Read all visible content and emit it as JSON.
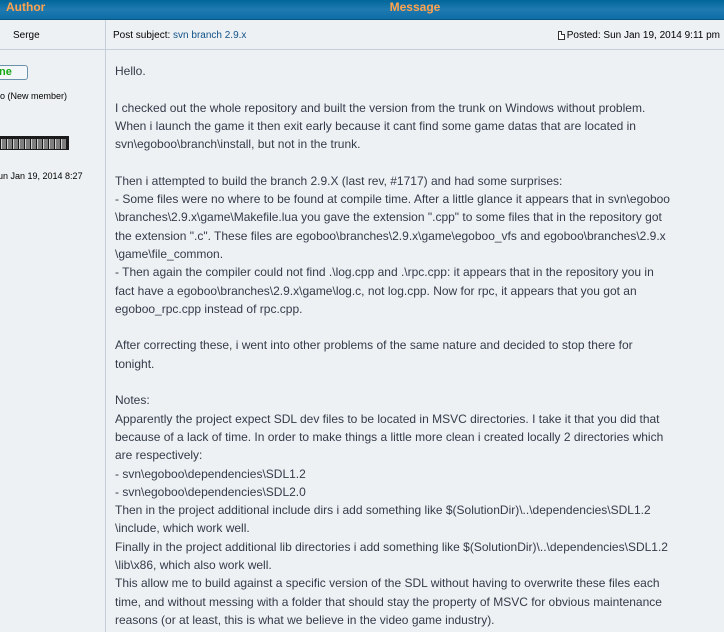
{
  "header": {
    "author": "Author",
    "message": "Message"
  },
  "post": {
    "author": "Serge",
    "subject_prefix": "Post subject:",
    "subject": "svn branch 2.9.x",
    "posted": "Posted: Sun Jan 19, 2014 9:11 pm"
  },
  "profile": {
    "online": "ne",
    "rank": "o (New member)",
    "joined": "un Jan 19, 2014 8:27"
  },
  "message": {
    "lines": [
      "Hello.",
      "",
      "I checked out the whole repository and built the version from the trunk on Windows without problem.",
      "When i launch the game it then exit early because it cant find some game datas that are located in",
      "svn\\egoboo\\branch\\install, but not in the trunk.",
      "",
      "Then i attempted to build the branch 2.9.X (last rev, #1717) and had some surprises:",
      "- Some files were no where to be found at compile time. After a little glance it appears that in svn\\egoboo",
      "\\branches\\2.9.x\\game\\Makefile.lua you gave the extension \".cpp\" to some files that in the repository got",
      "the extension \".c\". These files are egoboo\\branches\\2.9.x\\game\\egoboo_vfs and egoboo\\branches\\2.9.x",
      "\\game\\file_common.",
      "- Then again the compiler could not find .\\log.cpp and .\\rpc.cpp: it appears that in the repository you in",
      "fact have a egoboo\\branches\\2.9.x\\game\\log.c, not log.cpp. Now for rpc, it appears that you got an",
      "egoboo_rpc.cpp instead of rpc.cpp.",
      "",
      "After correcting these, i went into other problems of the same nature and decided to stop there for",
      "tonight.",
      "",
      "Notes:",
      "Apparently the project expect SDL dev files to be located in MSVC directories. I take it that you did that",
      "because of a lack of time. In order to make things a little more clean i created locally 2 directories which",
      "are respectively:",
      "- svn\\egoboo\\dependencies\\SDL1.2",
      "- svn\\egoboo\\dependencies\\SDL2.0",
      "Then in the project additional include dirs i add something like $(SolutionDir)\\..\\dependencies\\SDL1.2",
      "\\include, which work well.",
      "Finally in the project additional lib directories i add something like $(SolutionDir)\\..\\dependencies\\SDL1.2",
      "\\lib\\x86, which also work well.",
      "This allow me to build against a specific version of the SDL without having to overwrite these files each",
      "time, and without messing with a folder that should stay the property of MSVC for obvious maintenance",
      "reasons (or at least, this is what we believe in the video game industry)."
    ]
  }
}
